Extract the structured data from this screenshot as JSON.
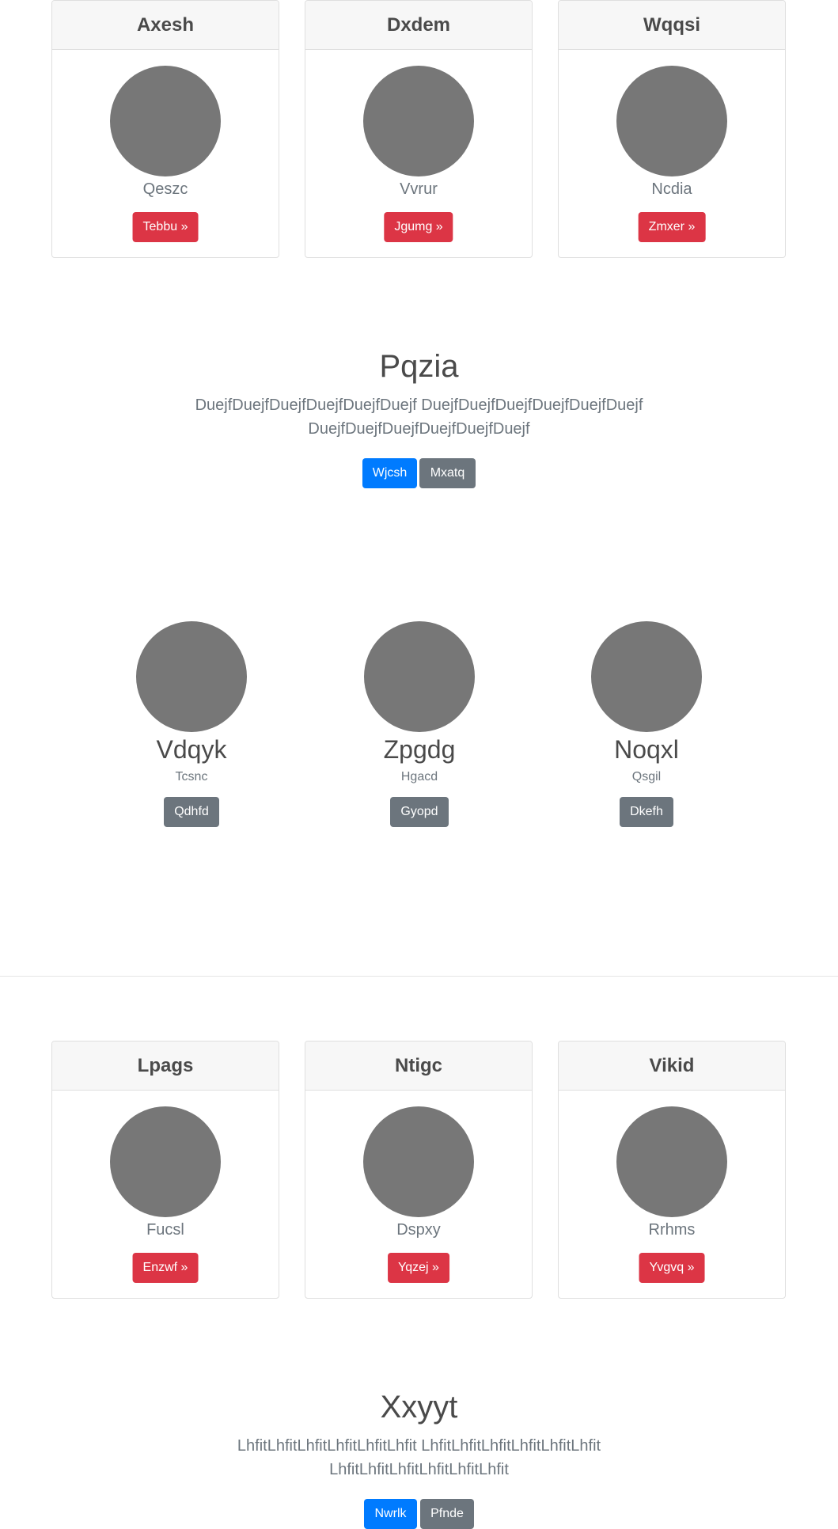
{
  "cards_top": [
    {
      "title": "Axesh",
      "name": "Qeszc",
      "button": "Tebbu »"
    },
    {
      "title": "Dxdem",
      "name": "Vvrur",
      "button": "Jgumg »"
    },
    {
      "title": "Wqqsi",
      "name": "Ncdia",
      "button": "Zmxer »"
    }
  ],
  "jumbo1": {
    "title": "Pqzia",
    "line1": "DuejfDuejfDuejfDuejfDuejfDuejf DuejfDuejfDuejfDuejfDuejfDuejf",
    "line2": "DuejfDuejfDuejfDuejfDuejfDuejf",
    "primary": "Wjcsh",
    "secondary": "Mxatq"
  },
  "people": [
    {
      "name": "Vdqyk",
      "sub": "Tcsnc",
      "button": "Qdhfd"
    },
    {
      "name": "Zpgdg",
      "sub": "Hgacd",
      "button": "Gyopd"
    },
    {
      "name": "Noqxl",
      "sub": "Qsgil",
      "button": "Dkefh"
    }
  ],
  "cards_bottom": [
    {
      "title": "Lpags",
      "name": "Fucsl",
      "button": "Enzwf »"
    },
    {
      "title": "Ntigc",
      "name": "Dspxy",
      "button": "Yqzej »"
    },
    {
      "title": "Vikid",
      "name": "Rrhms",
      "button": "Yvgvq »"
    }
  ],
  "jumbo2": {
    "title": "Xxyyt",
    "line1": "LhfitLhfitLhfitLhfitLhfitLhfit LhfitLhfitLhfitLhfitLhfitLhfit",
    "line2": "LhfitLhfitLhfitLhfitLhfitLhfit",
    "primary": "Nwrlk",
    "secondary": "Pfnde"
  },
  "colors": {
    "danger": "#dc3545",
    "primary": "#007bff",
    "secondary": "#6c757d",
    "avatar": "#777777"
  }
}
